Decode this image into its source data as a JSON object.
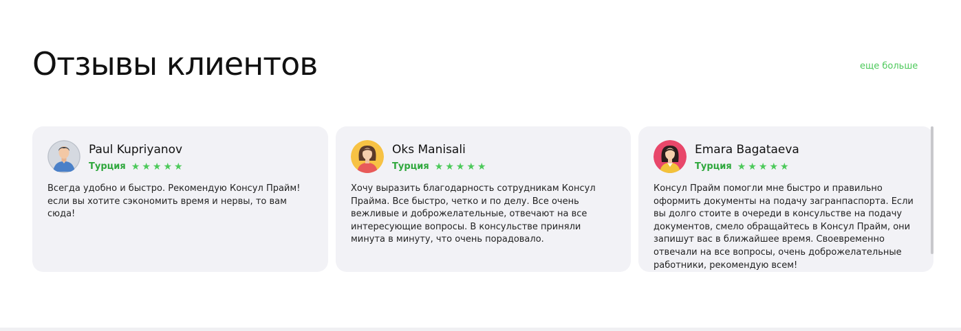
{
  "section": {
    "title": "Отзывы клиентов",
    "more_link": "еще больше"
  },
  "colors": {
    "accent": "#4cc95a",
    "country": "#2fa83d",
    "card_bg": "#f2f2f6"
  },
  "reviews": [
    {
      "name": "Paul Kupriyanov",
      "country": "Турция",
      "rating": 5,
      "avatar_icon": "man-avatar-icon",
      "text": "Всегда удобно и быстро. Рекомендую Консул Прайм! если вы хотите сэкономить время и нервы, то вам сюда!"
    },
    {
      "name": "Oks Manisali",
      "country": "Турция",
      "rating": 5,
      "avatar_icon": "woman-avatar-icon",
      "text": "Хочу выразить благодарность сотрудникам Консул Прайма. Все быстро, четко и по делу. Все очень вежливые и доброжелательные, отвечают на все интересующие вопросы. В консульстве приняли минута в минуту, что очень порадовало."
    },
    {
      "name": "Emara Bagataeva",
      "country": "Турция",
      "rating": 5,
      "avatar_icon": "woman-avatar-icon",
      "text": "Консул Прайм помогли мне быстро и правильно оформить документы на подачу загранпаспорта. Если вы долго стоите в очереди в консульстве на подачу документов, смело обращайтесь в Консул Прайм, они запишут вас в ближайшее время. Своевременно отвечали на все вопросы, очень доброжелательные работники, рекомендую всем!"
    }
  ]
}
